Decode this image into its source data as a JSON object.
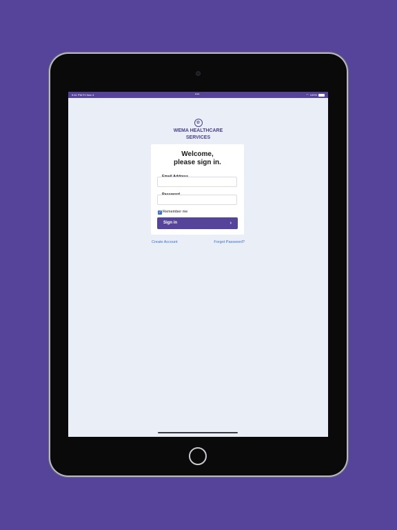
{
  "status_bar": {
    "time": "9:41 PM   Fri Nov 4",
    "center_dots": "•••",
    "battery_text": "100%"
  },
  "logo": {
    "line1": "WEMA HEALTHCARE",
    "line2": "SERVICES"
  },
  "login_card": {
    "welcome_line1": "Welcome,",
    "welcome_line2": "please sign in.",
    "email_label": "Email Address",
    "email_value": "",
    "password_label": "Password",
    "password_value": "",
    "remember_label": "Remember me",
    "remember_checked": true,
    "signin_label": "Sign in"
  },
  "links": {
    "create_account": "Create Account",
    "forgot_password": "Forgot Password?"
  },
  "colors": {
    "brand_purple": "#55449a",
    "link_blue": "#3a6fd6",
    "screen_bg": "#eaeef6"
  }
}
